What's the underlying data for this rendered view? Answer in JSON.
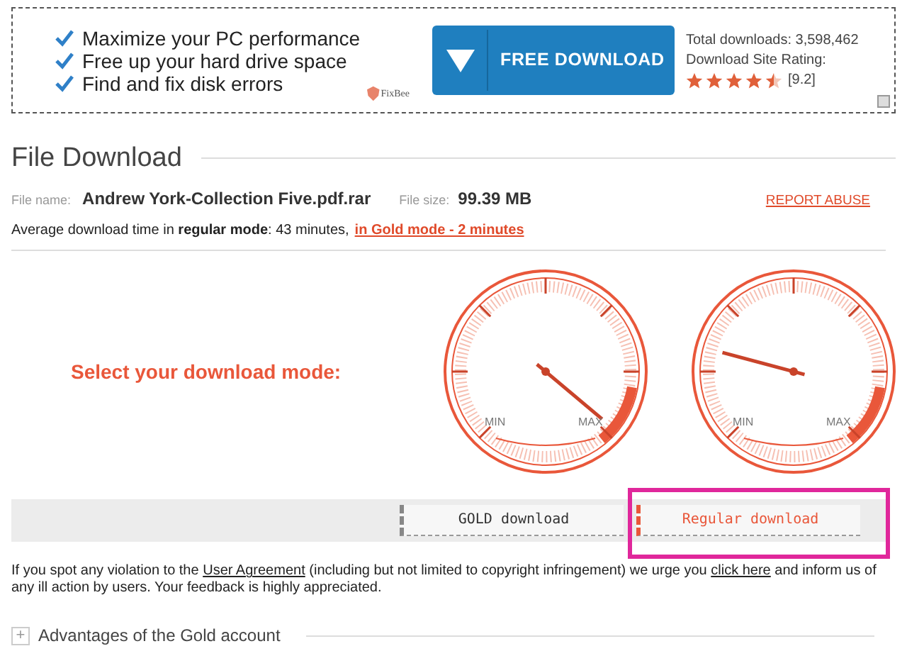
{
  "ad": {
    "features": [
      "Maximize your PC performance",
      "Free up your hard drive space",
      "Find and fix disk errors"
    ],
    "brand": "FixBee",
    "button": "FREE DOWNLOAD",
    "downloads": "Total downloads: 3,598,462",
    "rating_label": "Download Site Rating:",
    "stars": 4.5,
    "rating": "[9.2]"
  },
  "title": "File Download",
  "file": {
    "name_label": "File name:",
    "name": "Andrew York-Collection Five.pdf.rar",
    "size_label": "File size:",
    "size": "99.39 MB",
    "report": "REPORT ABUSE"
  },
  "average": {
    "text": "Average download time in **regular mode**: 43 minutes,",
    "link": "in Gold mode - 2 minutes"
  },
  "mode_prompt": "Select your download mode:",
  "gauges": [
    {
      "min": "MIN",
      "max": "MAX"
    },
    {
      "min": "MIN",
      "max": "MAX"
    }
  ],
  "buttons": [
    {
      "label": "GOLD download",
      "kind": "gold"
    },
    {
      "label": "Regular download",
      "kind": "regular"
    }
  ],
  "notice": {
    "before": "If you spot any violation to the",
    "agreement": "User Agreement",
    "middle": "(including but not limited to copyright infringement) we urge you",
    "click": "click here",
    "after": "and inform us of any ill action by users. Your feedback is highly appreciated."
  },
  "advantages": {
    "icon": "+",
    "label": "Advantages of the Gold account"
  }
}
